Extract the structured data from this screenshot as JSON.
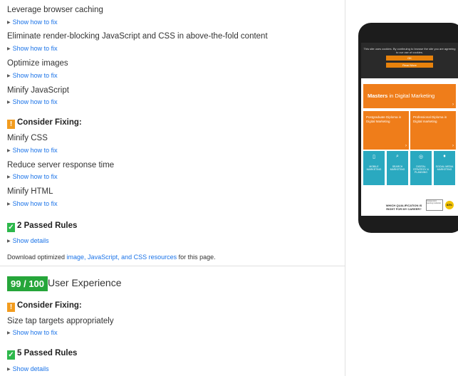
{
  "rules": [
    {
      "title": "Leverage browser caching",
      "link": "Show how to fix"
    },
    {
      "title": "Eliminate render-blocking JavaScript and CSS in above-the-fold content",
      "link": "Show how to fix"
    },
    {
      "title": "Optimize images",
      "link": "Show how to fix"
    },
    {
      "title": "Minify JavaScript",
      "link": "Show how to fix"
    }
  ],
  "consider1": {
    "heading": "Consider Fixing:",
    "rules": [
      {
        "title": "Minify CSS",
        "link": "Show how to fix"
      },
      {
        "title": "Reduce server response time",
        "link": "Show how to fix"
      },
      {
        "title": "Minify HTML",
        "link": "Show how to fix"
      }
    ]
  },
  "passed1": {
    "heading": "2 Passed Rules",
    "link": "Show details"
  },
  "download": {
    "prefix": "Download optimized ",
    "link": "image, JavaScript, and CSS resources",
    "suffix": " for this page."
  },
  "ux": {
    "score": "99 / 100",
    "title": "User Experience"
  },
  "consider2": {
    "heading": "Consider Fixing:",
    "rules": [
      {
        "title": "Size tap targets appropriately",
        "link": "Show how to fix"
      }
    ]
  },
  "passed2": {
    "heading": "5 Passed Rules",
    "link": "Show details"
  },
  "phone": {
    "cookie_text": "This site uses cookies. By continuing to browse the site you are agreeing to our use of cookies.",
    "ok": "OK",
    "read_more": "Read More",
    "masters_bold": "Masters",
    "masters_rest": " in Digital Marketing",
    "tile1": "Postgraduate Diploma in Digital Marketing",
    "tile2": "Professional Diploma in Digital marketing",
    "tiles_small": [
      "MOBILE MARKETING",
      "SEARCH MARKETING",
      "DIGITAL STRATEGY & PLANNING",
      "SOCIAL MEDIA MARKETING"
    ],
    "which": "WHICH QUALIFICATION IS RIGHT FOR MY CAREER?",
    "mini": "Independent learning institution",
    "pct": "83%"
  },
  "colors": {
    "link": "#1a73e8",
    "warn": "#f29c1f",
    "pass": "#2db84b",
    "score_bg": "#26a63a",
    "phone_orange": "#ef7d1a",
    "phone_blue": "#2aa9c0"
  }
}
